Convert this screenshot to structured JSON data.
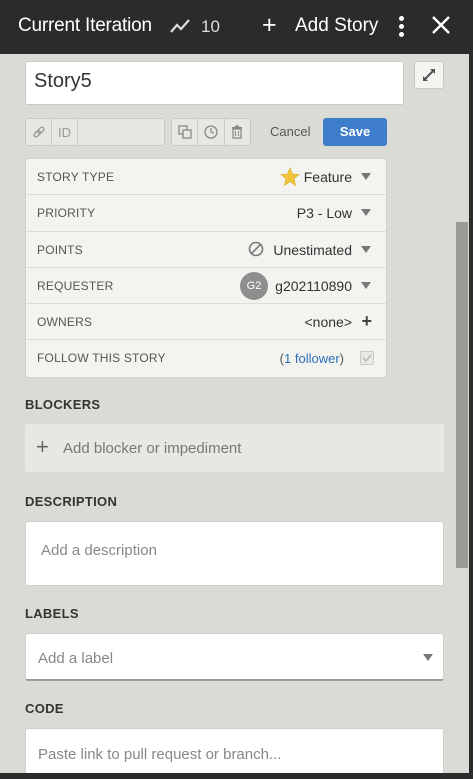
{
  "topbar": {
    "title": "Current Iteration",
    "velocity": "10",
    "add_story_plus": "+",
    "add_story_label": "Add Story"
  },
  "story": {
    "name": "Story5",
    "id_label": "ID",
    "id_value": "",
    "cancel_label": "Cancel",
    "save_label": "Save"
  },
  "fields": {
    "story_type": {
      "label": "STORY TYPE",
      "value": "Feature"
    },
    "priority": {
      "label": "PRIORITY",
      "value": "P3 - Low"
    },
    "points": {
      "label": "POINTS",
      "value": "Unestimated"
    },
    "requester": {
      "label": "REQUESTER",
      "initials": "G2",
      "value": "g202110890"
    },
    "owners": {
      "label": "OWNERS",
      "value": "<none>",
      "add": "+"
    },
    "follow": {
      "label": "FOLLOW THIS STORY",
      "open": "(",
      "link": "1 follower",
      "close": ")"
    }
  },
  "blockers": {
    "heading": "BLOCKERS",
    "plus": "+",
    "placeholder": "Add blocker or impediment"
  },
  "description": {
    "heading": "DESCRIPTION",
    "placeholder": "Add a description"
  },
  "labels": {
    "heading": "LABELS",
    "placeholder": "Add a label"
  },
  "code": {
    "heading": "CODE",
    "placeholder": "Paste link to pull request or branch..."
  },
  "colors": {
    "topbar_bg": "#2b2b2b",
    "save_button": "#3d7dca",
    "panel_bg": "#dbdbd5",
    "star": "#f0c33c",
    "link": "#2f6fb8"
  }
}
